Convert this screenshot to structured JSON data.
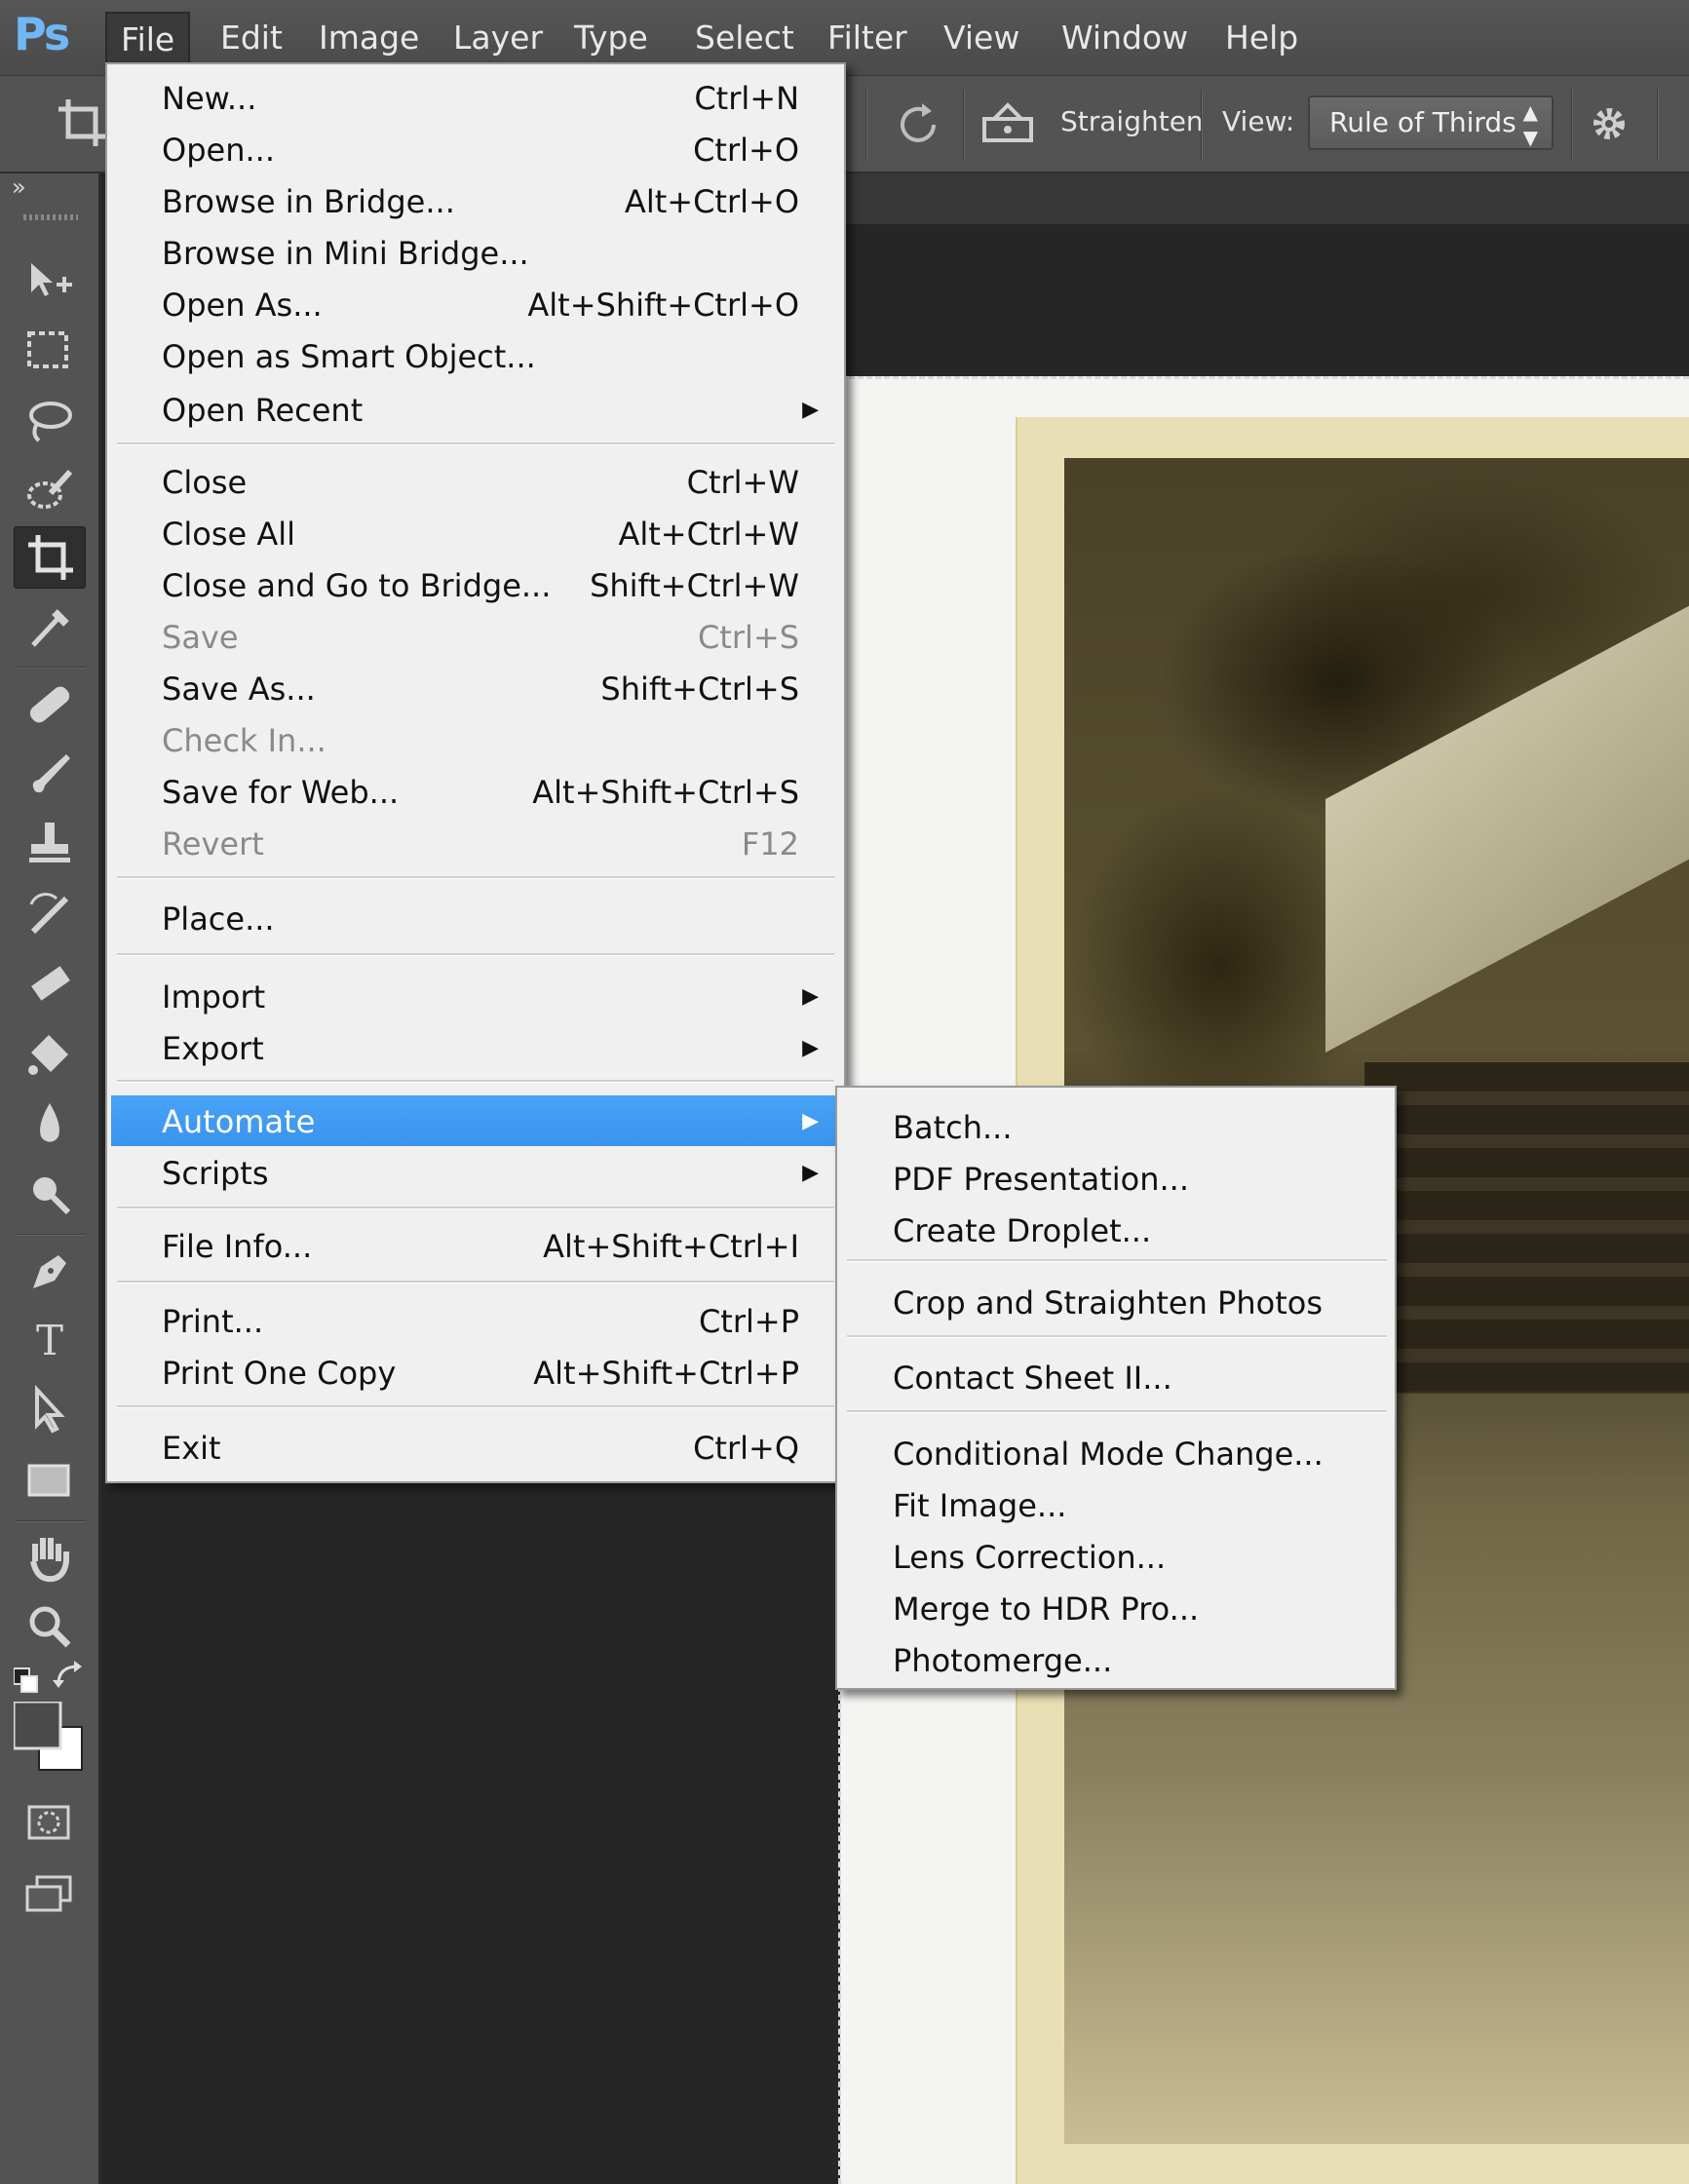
{
  "app": {
    "logo": "Ps",
    "menubar": [
      "File",
      "Edit",
      "Image",
      "Layer",
      "Type",
      "Select",
      "Filter",
      "View",
      "Window",
      "Help"
    ]
  },
  "options_bar": {
    "straighten_label": "Straighten",
    "view_label": "View:",
    "view_value": "Rule of Thirds",
    "icons": [
      "crop-icon",
      "rotate-icon",
      "straighten-icon",
      "gear-icon"
    ]
  },
  "toolbar": {
    "collapse": "»",
    "tools": [
      "move-tool-icon",
      "marquee-tool-icon",
      "lasso-tool-icon",
      "quick-selection-tool-icon",
      "crop-tool-icon",
      "eyedropper-tool-icon",
      "healing-brush-tool-icon",
      "brush-tool-icon",
      "clone-stamp-tool-icon",
      "history-brush-tool-icon",
      "eraser-tool-icon",
      "paint-bucket-tool-icon",
      "blur-tool-icon",
      "dodge-tool-icon",
      "pen-tool-icon",
      "type-tool-icon",
      "path-selection-tool-icon",
      "rectangle-tool-icon",
      "hand-tool-icon",
      "zoom-tool-icon",
      "default-colors-icon",
      "swap-colors-icon",
      "color-swatches-icon",
      "quick-mask-icon",
      "screen-mode-icon"
    ],
    "type_glyph": "T"
  },
  "file_menu": {
    "items": [
      {
        "label": "New...",
        "shortcut": "Ctrl+N"
      },
      {
        "label": "Open...",
        "shortcut": "Ctrl+O"
      },
      {
        "label": "Browse in Bridge...",
        "shortcut": "Alt+Ctrl+O"
      },
      {
        "label": "Browse in Mini Bridge...",
        "shortcut": ""
      },
      {
        "label": "Open As...",
        "shortcut": "Alt+Shift+Ctrl+O"
      },
      {
        "label": "Open as Smart Object...",
        "shortcut": ""
      },
      {
        "label": "Open Recent",
        "shortcut": ""
      },
      {
        "label": "Close",
        "shortcut": "Ctrl+W"
      },
      {
        "label": "Close All",
        "shortcut": "Alt+Ctrl+W"
      },
      {
        "label": "Close and Go to Bridge...",
        "shortcut": "Shift+Ctrl+W"
      },
      {
        "label": "Save",
        "shortcut": "Ctrl+S"
      },
      {
        "label": "Save As...",
        "shortcut": "Shift+Ctrl+S"
      },
      {
        "label": "Check In...",
        "shortcut": ""
      },
      {
        "label": "Save for Web...",
        "shortcut": "Alt+Shift+Ctrl+S"
      },
      {
        "label": "Revert",
        "shortcut": "F12"
      },
      {
        "label": "Place...",
        "shortcut": ""
      },
      {
        "label": "Import",
        "shortcut": ""
      },
      {
        "label": "Export",
        "shortcut": ""
      },
      {
        "label": "Automate",
        "shortcut": ""
      },
      {
        "label": "Scripts",
        "shortcut": ""
      },
      {
        "label": "File Info...",
        "shortcut": "Alt+Shift+Ctrl+I"
      },
      {
        "label": "Print...",
        "shortcut": "Ctrl+P"
      },
      {
        "label": "Print One Copy",
        "shortcut": "Alt+Shift+Ctrl+P"
      },
      {
        "label": "Exit",
        "shortcut": "Ctrl+Q"
      }
    ],
    "submenu_arrow": "▶"
  },
  "automate_menu": {
    "items": [
      "Batch...",
      "PDF Presentation...",
      "Create Droplet...",
      "Crop and Straighten Photos",
      "Contact Sheet II...",
      "Conditional Mode Change...",
      "Fit Image...",
      "Lens Correction...",
      "Merge to HDR Pro...",
      "Photomerge..."
    ]
  },
  "colors": {
    "menu_highlight": "#3a93ed",
    "logo_blue": "#6fb7f5",
    "panel_gray": "#535353",
    "canvas_dark": "#262626",
    "disabled_text": "#8a8a8a"
  }
}
